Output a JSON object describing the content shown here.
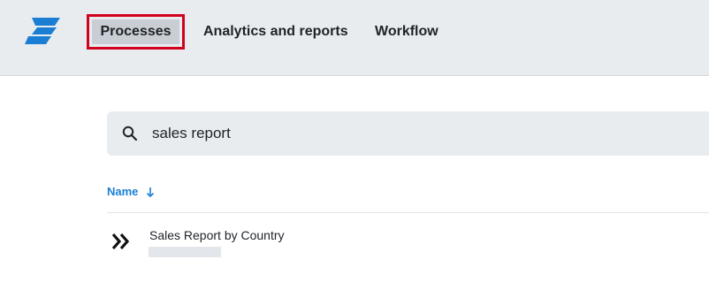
{
  "nav": {
    "items": [
      {
        "label": "Processes",
        "active": true
      },
      {
        "label": "Analytics and reports",
        "active": false
      },
      {
        "label": "Workflow",
        "active": false
      }
    ],
    "highlight_color": "#d0021b",
    "logo_color": "#1a7fd4"
  },
  "search": {
    "value": "sales report",
    "icon": "search-icon"
  },
  "list": {
    "column_header": "Name",
    "sort_direction": "descending",
    "rows": [
      {
        "title": "Sales Report by Country",
        "icon": "double-chevron-right-icon"
      }
    ]
  },
  "colors": {
    "accent": "#1a7fd4",
    "topbar_bg": "#e9ecef"
  }
}
